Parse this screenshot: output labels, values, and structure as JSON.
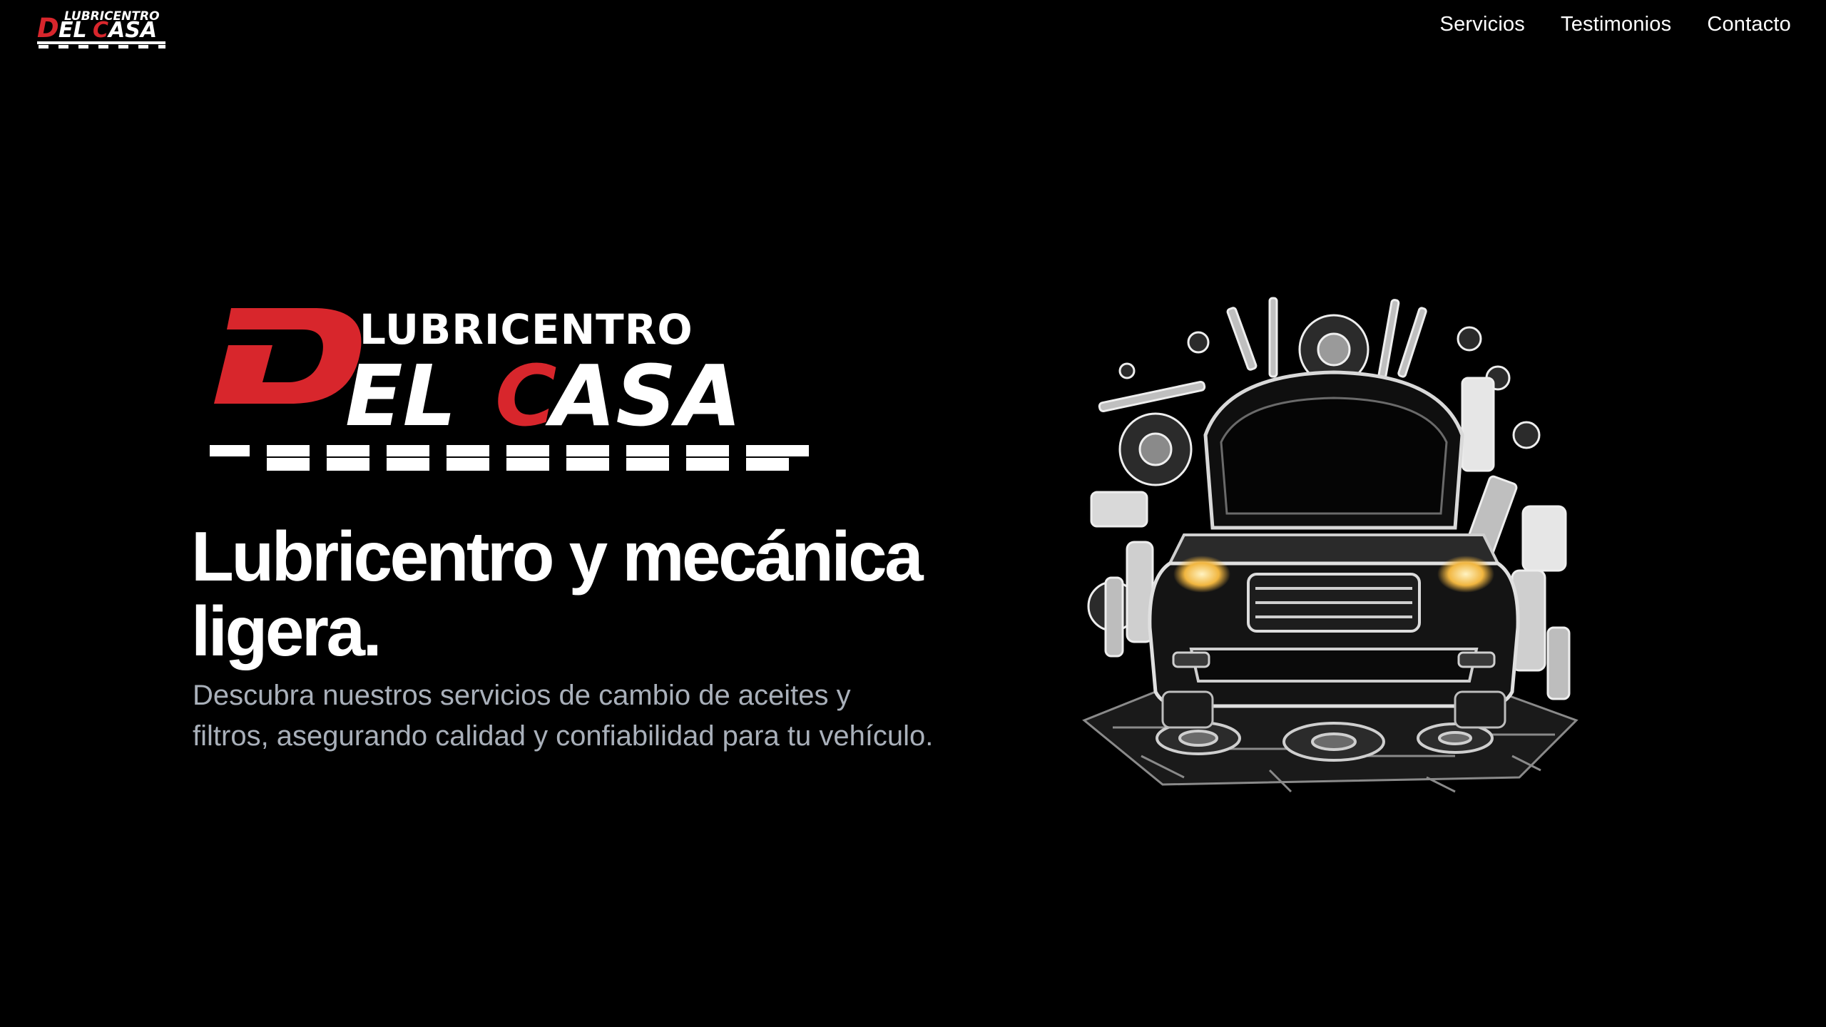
{
  "header": {
    "logo": {
      "top_text": "LUBRICENTRO",
      "main_text": "DELCASA",
      "accent_color": "#d8262c"
    },
    "nav": [
      {
        "label": "Servicios"
      },
      {
        "label": "Testimonios"
      },
      {
        "label": "Contacto"
      }
    ]
  },
  "hero": {
    "logo": {
      "top_text": "LUBRICENTRO",
      "main_text": "DELCASA",
      "accent_color": "#d8262c"
    },
    "title_line1": "Lubricentro y mecánica",
    "title_line2": "ligera.",
    "description": "Descubra nuestros servicios de cambio de aceites y filtros, asegurando calidad y confiabilidad para tu vehículo.",
    "illustration_icon": "car-with-tools-illustration"
  },
  "colors": {
    "background": "#000000",
    "text": "#ffffff",
    "muted_text": "#a9b0ba",
    "brand_red": "#d8262c"
  }
}
